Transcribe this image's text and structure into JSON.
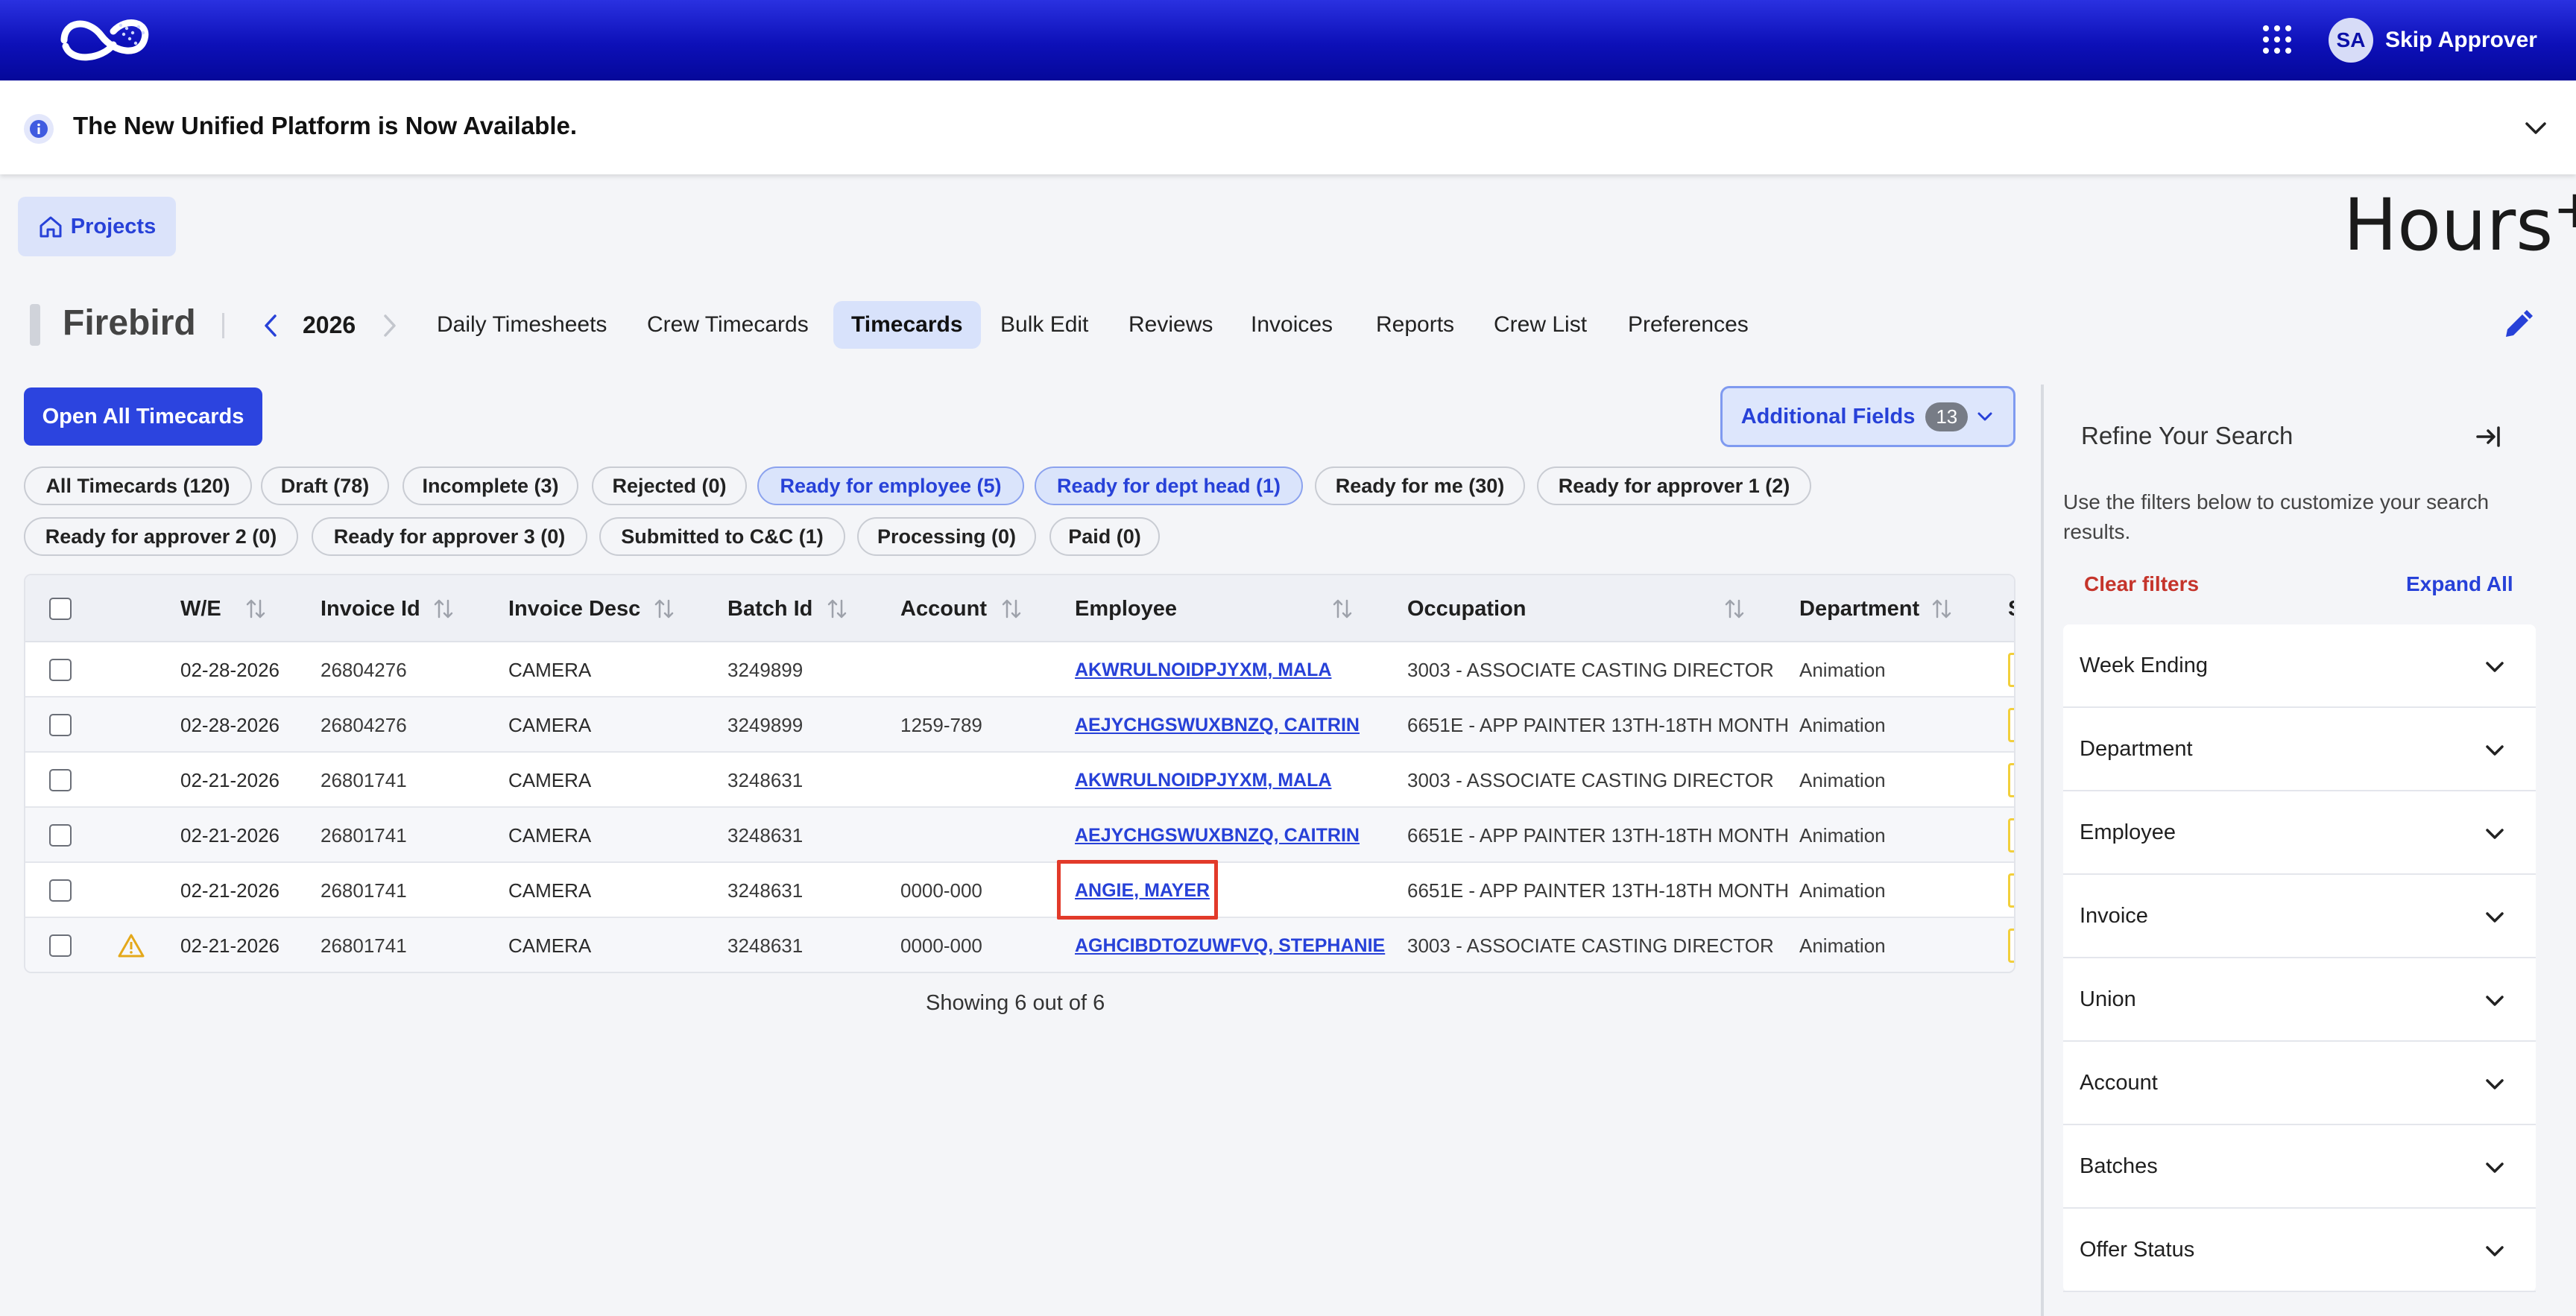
{
  "header": {
    "user_initials": "SA",
    "user_name": "Skip Approver"
  },
  "banner": {
    "text": "The New Unified Platform is Now Available."
  },
  "projects_button": "Projects",
  "brand": {
    "name": "Hours",
    "suffix": "+"
  },
  "project": {
    "name": "Firebird",
    "year": "2026"
  },
  "nav_tabs": [
    "Daily Timesheets",
    "Crew Timecards",
    "Timecards",
    "Bulk Edit",
    "Reviews",
    "Invoices",
    "Reports",
    "Crew List",
    "Preferences"
  ],
  "active_tab": "Timecards",
  "actions": {
    "open_all": "Open All Timecards",
    "additional_fields": "Additional Fields",
    "additional_fields_count": "13"
  },
  "chips": [
    "All Timecards (120)",
    "Draft (78)",
    "Incomplete (3)",
    "Rejected (0)",
    "Ready for employee (5)",
    "Ready for dept head (1)",
    "Ready for me (30)",
    "Ready for approver 1 (2)",
    "Ready for approver 2 (0)",
    "Ready for approver 3 (0)",
    "Submitted to C&C (1)",
    "Processing (0)",
    "Paid (0)"
  ],
  "table": {
    "columns": [
      "W/E",
      "Invoice Id",
      "Invoice Desc",
      "Batch Id",
      "Account",
      "Employee",
      "Occupation",
      "Department",
      "S"
    ],
    "rows": [
      {
        "we": "02-28-2026",
        "invoice_id": "26804276",
        "invoice_desc": "CAMERA",
        "batch_id": "3249899",
        "account": "",
        "employee": "AKWRULNOIDPJYXM, MALA",
        "occupation": "3003 - ASSOCIATE CASTING DIRECTOR",
        "department": "Animation",
        "warning": false
      },
      {
        "we": "02-28-2026",
        "invoice_id": "26804276",
        "invoice_desc": "CAMERA",
        "batch_id": "3249899",
        "account": "1259-789",
        "employee": "AEJYCHGSWUXBNZQ, CAITRIN",
        "occupation": "6651E - APP PAINTER 13TH-18TH MONTH",
        "department": "Animation",
        "warning": false
      },
      {
        "we": "02-21-2026",
        "invoice_id": "26801741",
        "invoice_desc": "CAMERA",
        "batch_id": "3248631",
        "account": "",
        "employee": "AKWRULNOIDPJYXM, MALA",
        "occupation": "3003 - ASSOCIATE CASTING DIRECTOR",
        "department": "Animation",
        "warning": false
      },
      {
        "we": "02-21-2026",
        "invoice_id": "26801741",
        "invoice_desc": "CAMERA",
        "batch_id": "3248631",
        "account": "",
        "employee": "AEJYCHGSWUXBNZQ, CAITRIN",
        "occupation": "6651E - APP PAINTER 13TH-18TH MONTH",
        "department": "Animation",
        "warning": false
      },
      {
        "we": "02-21-2026",
        "invoice_id": "26801741",
        "invoice_desc": "CAMERA",
        "batch_id": "3248631",
        "account": "0000-000",
        "employee": "ANGIE, MAYER",
        "occupation": "6651E - APP PAINTER 13TH-18TH MONTH",
        "department": "Animation",
        "warning": false
      },
      {
        "we": "02-21-2026",
        "invoice_id": "26801741",
        "invoice_desc": "CAMERA",
        "batch_id": "3248631",
        "account": "0000-000",
        "employee": "AGHCIBDTOZUWFVQ, STEPHANIE",
        "occupation": "3003 - ASSOCIATE CASTING DIRECTOR",
        "department": "Animation",
        "warning": true
      }
    ],
    "showing": "Showing 6 out of 6"
  },
  "filter_panel": {
    "title": "Refine Your Search",
    "description": "Use the filters below to customize your search results.",
    "clear": "Clear filters",
    "expand": "Expand All",
    "items": [
      "Week Ending",
      "Department",
      "Employee",
      "Invoice",
      "Union",
      "Account",
      "Batches",
      "Offer Status"
    ]
  },
  "colors": {
    "header_blue": "#0d10b8",
    "primary": "#2c44df",
    "link": "#2741d8",
    "danger": "#c5342b",
    "highlight_outline": "#e23a2a",
    "status_tag": "#f2cf3b"
  }
}
